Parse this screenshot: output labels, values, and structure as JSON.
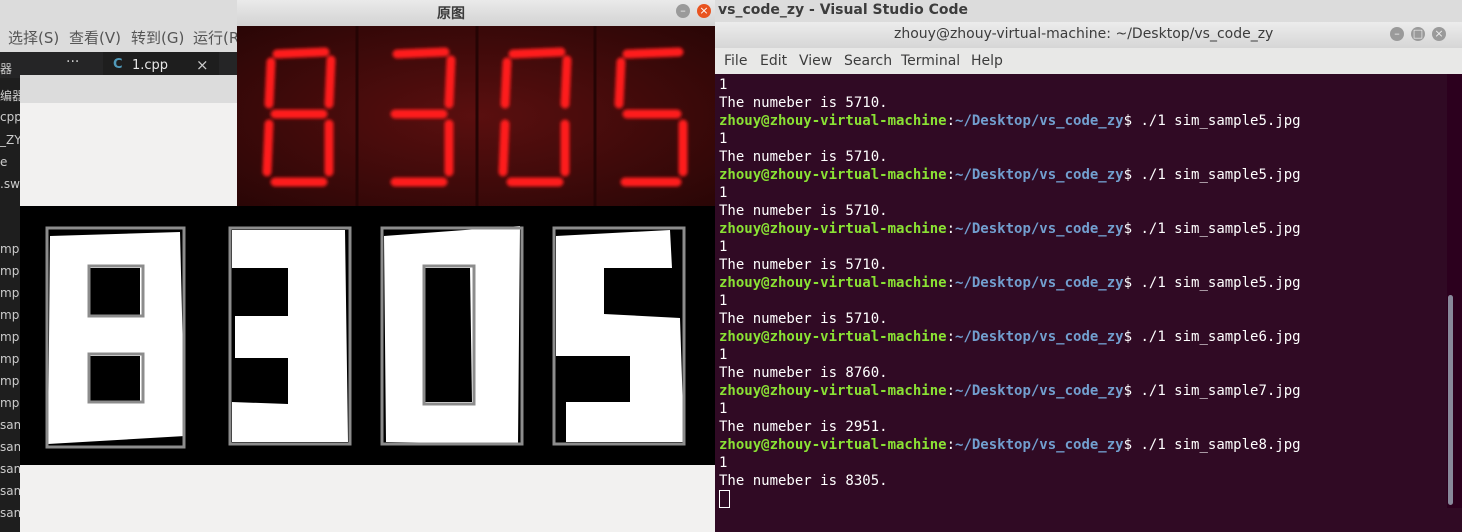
{
  "vscode": {
    "title": "vs_code_zy - Visual Studio Code",
    "menus": [
      "选择(S)",
      "查看(V)",
      "转到(G)",
      "运行(R"
    ],
    "tab_icon": "C",
    "tab_label": "1.cpp",
    "tab_close": "×",
    "more": "···",
    "sidebar": [
      "器",
      "编器",
      "cpp",
      "_ZY",
      "e",
      ".swp",
      "mp",
      "mp",
      "mp",
      "mp",
      "mp",
      "mp",
      "mp",
      "mp",
      "sam",
      "sam",
      "sam",
      "sam",
      "sam"
    ]
  },
  "original_window": {
    "title": "原图",
    "min_icon": "minimize-icon",
    "close_icon": "close-icon",
    "close_glyph": "×",
    "min_glyph": "–",
    "digits": [
      "8",
      "3",
      "0",
      "5"
    ],
    "digit_color": "#ff1e1e"
  },
  "binary_window": {
    "digits": [
      "8",
      "3",
      "0",
      "5"
    ]
  },
  "terminal": {
    "title": "zhouy@zhouy-virtual-machine: ~/Desktop/vs_code_zy",
    "menus": [
      "File",
      "Edit",
      "View",
      "Search",
      "Terminal",
      "Help"
    ],
    "user_host": "zhouy@zhouy-virtual-machine",
    "path": "~/Desktop/vs_code_zy",
    "lines": [
      {
        "t": "out",
        "text": "1"
      },
      {
        "t": "out",
        "text": "The numeber is 5710."
      },
      {
        "t": "cmd",
        "text": " ./1 sim_sample5.jpg"
      },
      {
        "t": "out",
        "text": "1"
      },
      {
        "t": "out",
        "text": "The numeber is 5710."
      },
      {
        "t": "cmd",
        "text": " ./1 sim_sample5.jpg"
      },
      {
        "t": "out",
        "text": "1"
      },
      {
        "t": "out",
        "text": "The numeber is 5710."
      },
      {
        "t": "cmd",
        "text": " ./1 sim_sample5.jpg"
      },
      {
        "t": "out",
        "text": "1"
      },
      {
        "t": "out",
        "text": "The numeber is 5710."
      },
      {
        "t": "cmd",
        "text": " ./1 sim_sample5.jpg"
      },
      {
        "t": "out",
        "text": "1"
      },
      {
        "t": "out",
        "text": "The numeber is 5710."
      },
      {
        "t": "cmd",
        "text": " ./1 sim_sample6.jpg"
      },
      {
        "t": "out",
        "text": "1"
      },
      {
        "t": "out",
        "text": "The numeber is 8760."
      },
      {
        "t": "cmd",
        "text": " ./1 sim_sample7.jpg"
      },
      {
        "t": "out",
        "text": "1"
      },
      {
        "t": "out",
        "text": "The numeber is 2951."
      },
      {
        "t": "cmd",
        "text": " ./1 sim_sample8.jpg"
      },
      {
        "t": "out",
        "text": "1"
      },
      {
        "t": "out",
        "text": "The numeber is 8305."
      }
    ]
  }
}
